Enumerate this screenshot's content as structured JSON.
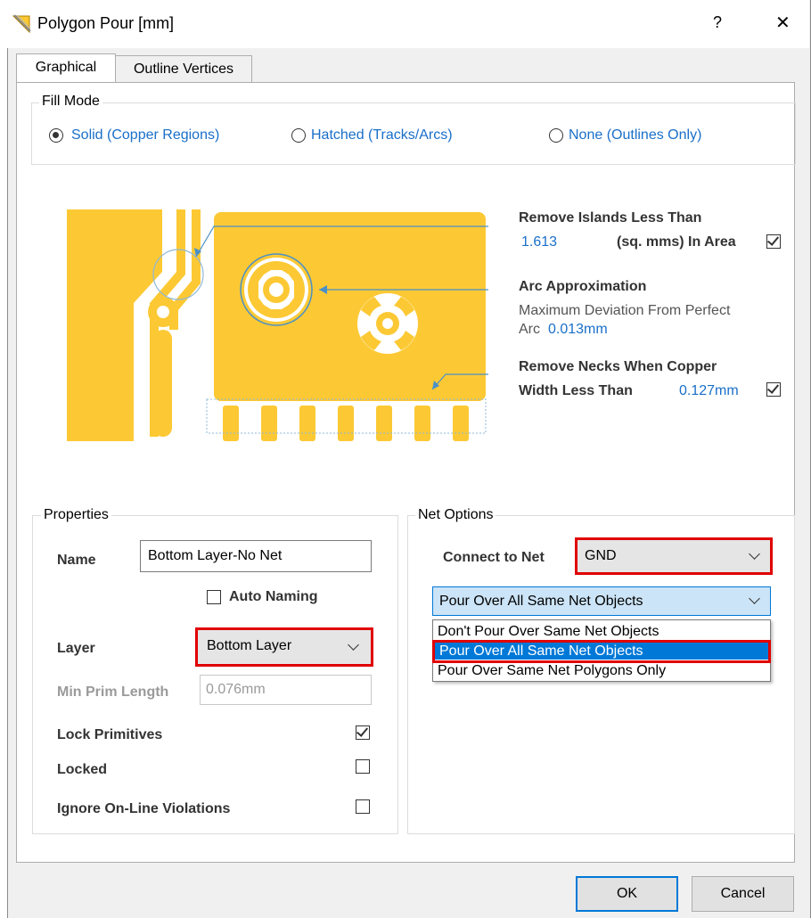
{
  "window": {
    "title": "Polygon Pour [mm]",
    "help_label": "?",
    "close_label": "✕"
  },
  "tabs": [
    {
      "label": "Graphical",
      "active": true
    },
    {
      "label": "Outline Vertices",
      "active": false
    }
  ],
  "fill_mode": {
    "label": "Fill Mode",
    "options": [
      {
        "label": "Solid (Copper Regions)",
        "selected": true
      },
      {
        "label": "Hatched (Tracks/Arcs)",
        "selected": false
      },
      {
        "label": "None (Outlines Only)",
        "selected": false
      }
    ]
  },
  "preview": {
    "copper_color": "#fcc934",
    "remove_islands": {
      "title": "Remove Islands Less Than",
      "value": "1.613",
      "unit": "(sq. mms) In Area",
      "checked": true
    },
    "arc_approx": {
      "title": "Arc Approximation",
      "line1": "Maximum Deviation From Perfect",
      "line2_prefix": "Arc",
      "value": "0.013mm"
    },
    "remove_necks": {
      "title": "Remove Necks When Copper",
      "line2": "Width Less Than",
      "value": "0.127mm",
      "checked": true
    }
  },
  "properties": {
    "label": "Properties",
    "name_label": "Name",
    "name_value": "Bottom Layer-No Net",
    "auto_naming_label": "Auto Naming",
    "auto_naming_checked": false,
    "layer_label": "Layer",
    "layer_value": "Bottom Layer",
    "min_prim_label": "Min Prim Length",
    "min_prim_value": "0.076mm",
    "lock_primitives_label": "Lock Primitives",
    "lock_primitives_checked": true,
    "locked_label": "Locked",
    "locked_checked": false,
    "ignore_online_label": "Ignore On-Line Violations",
    "ignore_online_checked": false
  },
  "net_options": {
    "label": "Net Options",
    "connect_label": "Connect to Net",
    "connect_value": "GND",
    "pour_value": "Pour Over All Same Net Objects",
    "pour_options": [
      {
        "label": "Don't Pour Over Same Net Objects",
        "selected": false
      },
      {
        "label": "Pour Over All Same Net Objects",
        "selected": true
      },
      {
        "label": "Pour Over Same Net Polygons Only",
        "selected": false
      }
    ]
  },
  "buttons": {
    "ok": "OK",
    "cancel": "Cancel"
  },
  "colors": {
    "accent": "#0078d7",
    "highlight_red": "#e00000",
    "link_blue": "#1a6fc9"
  }
}
